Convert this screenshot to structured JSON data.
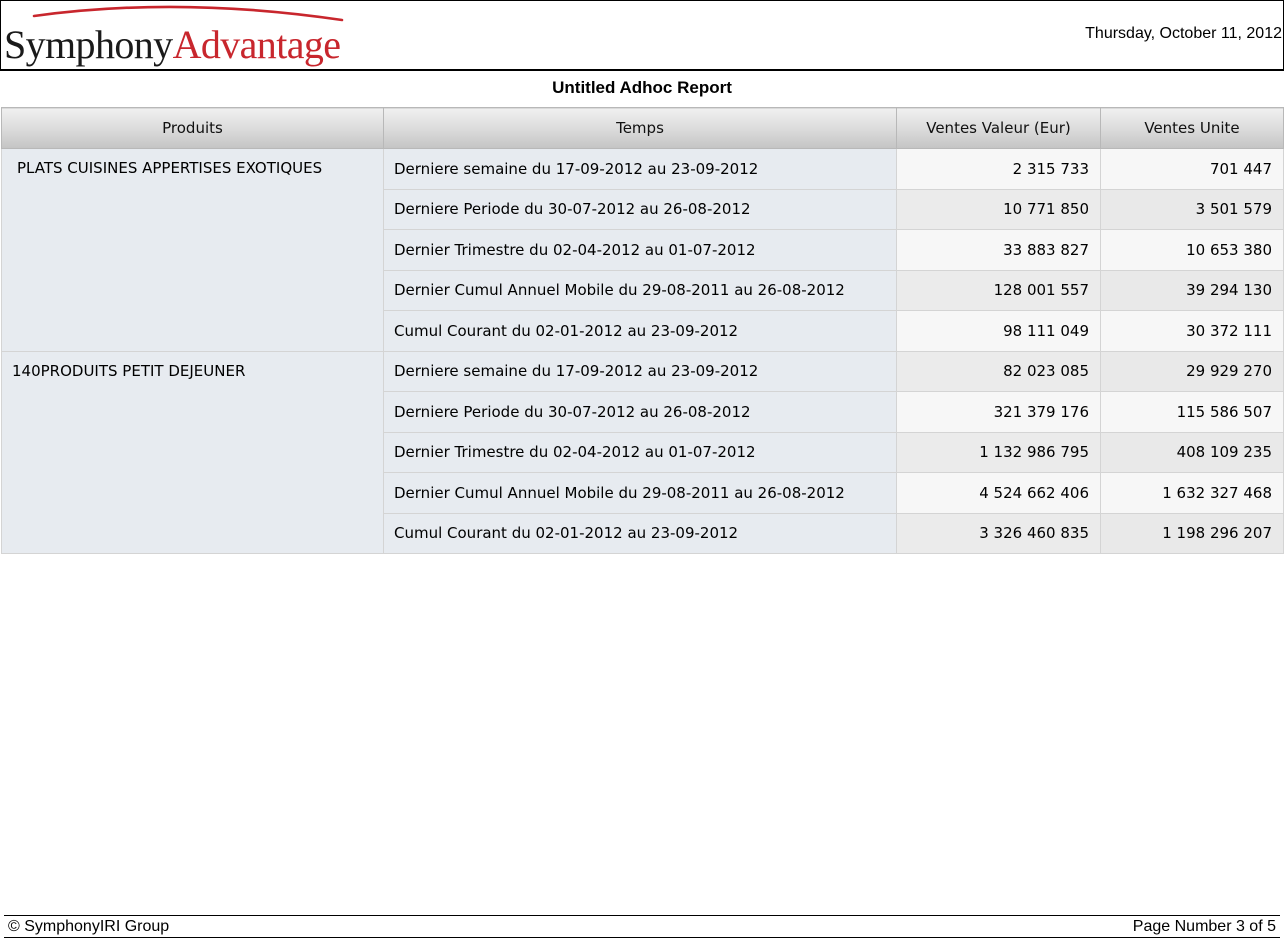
{
  "brand": {
    "name_part1": "Symphony",
    "name_part2": "Advantage",
    "color_dark": "#1a1a1a",
    "color_accent": "#c8262d"
  },
  "header": {
    "date": "Thursday, October 11, 2012"
  },
  "report": {
    "title": "Untitled Adhoc Report",
    "columns": [
      "Produits",
      "Temps",
      "Ventes Valeur (Eur)",
      "Ventes Unite"
    ],
    "groups": [
      {
        "product": "PLATS CUISINES APPERTISES EXOTIQUES",
        "rows": [
          {
            "period": "Derniere semaine du 17-09-2012 au 23-09-2012",
            "value": "2 315 733",
            "units": "701 447"
          },
          {
            "period": "Derniere Periode du 30-07-2012 au 26-08-2012",
            "value": "10 771 850",
            "units": "3 501 579"
          },
          {
            "period": "Dernier Trimestre du 02-04-2012 au 01-07-2012",
            "value": "33 883 827",
            "units": "10 653 380"
          },
          {
            "period": "Dernier Cumul Annuel Mobile du 29-08-2011 au 26-08-2012",
            "value": "128 001 557",
            "units": "39 294 130"
          },
          {
            "period": "Cumul Courant du 02-01-2012 au 23-09-2012",
            "value": "98 111 049",
            "units": "30 372 111"
          }
        ]
      },
      {
        "product": "140PRODUITS PETIT DEJEUNER",
        "rows": [
          {
            "period": "Derniere semaine du 17-09-2012 au 23-09-2012",
            "value": "82 023 085",
            "units": "29 929 270"
          },
          {
            "period": "Derniere Periode du 30-07-2012 au 26-08-2012",
            "value": "321 379 176",
            "units": "115 586 507"
          },
          {
            "period": "Dernier Trimestre du 02-04-2012 au 01-07-2012",
            "value": "1 132 986 795",
            "units": "408 109 235"
          },
          {
            "period": "Dernier Cumul Annuel Mobile du 29-08-2011 au 26-08-2012",
            "value": "4 524 662 406",
            "units": "1 632 327 468"
          },
          {
            "period": "Cumul Courant du 02-01-2012 au 23-09-2012",
            "value": "3 326 460 835",
            "units": "1 198 296 207"
          }
        ]
      }
    ]
  },
  "footer": {
    "copyright": "© SymphonyIRI Group",
    "page_number": "Page Number 3 of 5"
  }
}
